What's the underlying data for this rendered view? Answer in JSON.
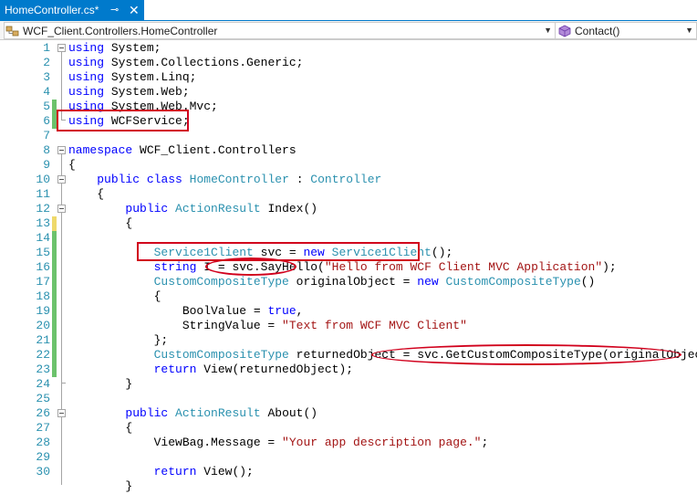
{
  "tab": {
    "title": "HomeController.cs*",
    "pin": "⊸",
    "close": "✕"
  },
  "navbar": {
    "class_path": "WCF_Client.Controllers.HomeController",
    "member": "Contact()"
  },
  "colors": {
    "accent": "#007acc",
    "keyword": "#0000ff",
    "type": "#2b91af",
    "string": "#a31515",
    "annotation": "#d1001c"
  },
  "lines": [
    {
      "n": "1",
      "t": [
        [
          "kw",
          "using"
        ],
        [
          "p",
          " System;"
        ]
      ]
    },
    {
      "n": "2",
      "t": [
        [
          "kw",
          "using"
        ],
        [
          "p",
          " System.Collections.Generic;"
        ]
      ]
    },
    {
      "n": "3",
      "t": [
        [
          "kw",
          "using"
        ],
        [
          "p",
          " System.Linq;"
        ]
      ]
    },
    {
      "n": "4",
      "t": [
        [
          "kw",
          "using"
        ],
        [
          "p",
          " System.Web;"
        ]
      ]
    },
    {
      "n": "5",
      "t": [
        [
          "kw",
          "using"
        ],
        [
          "p",
          " System.Web.Mvc;"
        ]
      ]
    },
    {
      "n": "6",
      "t": [
        [
          "kw",
          "using"
        ],
        [
          "p",
          " WCFService;"
        ]
      ]
    },
    {
      "n": "7",
      "t": []
    },
    {
      "n": "8",
      "t": [
        [
          "kw",
          "namespace"
        ],
        [
          "p",
          " WCF_Client.Controllers"
        ]
      ]
    },
    {
      "n": "9",
      "t": [
        [
          "p",
          "{"
        ]
      ]
    },
    {
      "n": "10",
      "t": [
        [
          "p",
          "    "
        ],
        [
          "kw",
          "public"
        ],
        [
          "p",
          " "
        ],
        [
          "kw",
          "class"
        ],
        [
          "p",
          " "
        ],
        [
          "ty",
          "HomeController"
        ],
        [
          "p",
          " : "
        ],
        [
          "ty",
          "Controller"
        ]
      ]
    },
    {
      "n": "11",
      "t": [
        [
          "p",
          "    {"
        ]
      ]
    },
    {
      "n": "12",
      "t": [
        [
          "p",
          "        "
        ],
        [
          "kw",
          "public"
        ],
        [
          "p",
          " "
        ],
        [
          "ty",
          "ActionResult"
        ],
        [
          "p",
          " Index()"
        ]
      ]
    },
    {
      "n": "13",
      "t": [
        [
          "p",
          "        {"
        ]
      ]
    },
    {
      "n": "14",
      "t": []
    },
    {
      "n": "15",
      "t": [
        [
          "p",
          "            "
        ],
        [
          "ty",
          "Service1Client"
        ],
        [
          "p",
          " svc = "
        ],
        [
          "kw",
          "new"
        ],
        [
          "p",
          " "
        ],
        [
          "ty",
          "Service1Client"
        ],
        [
          "p",
          "();"
        ]
      ]
    },
    {
      "n": "16",
      "t": [
        [
          "p",
          "            "
        ],
        [
          "kw",
          "string"
        ],
        [
          "p",
          " I = svc.SayHello("
        ],
        [
          "st",
          "\"Hello from WCF Client MVC Application\""
        ],
        [
          "p",
          ");"
        ]
      ]
    },
    {
      "n": "17",
      "t": [
        [
          "p",
          "            "
        ],
        [
          "ty",
          "CustomCompositeType"
        ],
        [
          "p",
          " originalObject = "
        ],
        [
          "kw",
          "new"
        ],
        [
          "p",
          " "
        ],
        [
          "ty",
          "CustomCompositeType"
        ],
        [
          "p",
          "()"
        ]
      ]
    },
    {
      "n": "18",
      "t": [
        [
          "p",
          "            {"
        ]
      ]
    },
    {
      "n": "19",
      "t": [
        [
          "p",
          "                BoolValue = "
        ],
        [
          "kw",
          "true"
        ],
        [
          "p",
          ","
        ]
      ]
    },
    {
      "n": "20",
      "t": [
        [
          "p",
          "                StringValue = "
        ],
        [
          "st",
          "\"Text from WCF MVC Client\""
        ]
      ]
    },
    {
      "n": "21",
      "t": [
        [
          "p",
          "            };"
        ]
      ]
    },
    {
      "n": "22",
      "t": [
        [
          "p",
          "            "
        ],
        [
          "ty",
          "CustomCompositeType"
        ],
        [
          "p",
          " returnedObject = svc.GetCustomCompositeType(originalObject);"
        ]
      ]
    },
    {
      "n": "23",
      "t": [
        [
          "p",
          "            "
        ],
        [
          "kw",
          "return"
        ],
        [
          "p",
          " View(returnedObject);"
        ]
      ]
    },
    {
      "n": "24",
      "t": [
        [
          "p",
          "        }"
        ]
      ]
    },
    {
      "n": "25",
      "t": []
    },
    {
      "n": "26",
      "t": [
        [
          "p",
          "        "
        ],
        [
          "kw",
          "public"
        ],
        [
          "p",
          " "
        ],
        [
          "ty",
          "ActionResult"
        ],
        [
          "p",
          " About()"
        ]
      ]
    },
    {
      "n": "27",
      "t": [
        [
          "p",
          "        {"
        ]
      ]
    },
    {
      "n": "28",
      "t": [
        [
          "p",
          "            ViewBag.Message = "
        ],
        [
          "st",
          "\"Your app description page.\""
        ],
        [
          "p",
          ";"
        ]
      ]
    },
    {
      "n": "29",
      "t": []
    },
    {
      "n": "30",
      "t": [
        [
          "p",
          "            "
        ],
        [
          "kw",
          "return"
        ],
        [
          "p",
          " View();"
        ]
      ]
    },
    {
      "n": "",
      "t": [
        [
          "p",
          "        }"
        ]
      ]
    }
  ]
}
